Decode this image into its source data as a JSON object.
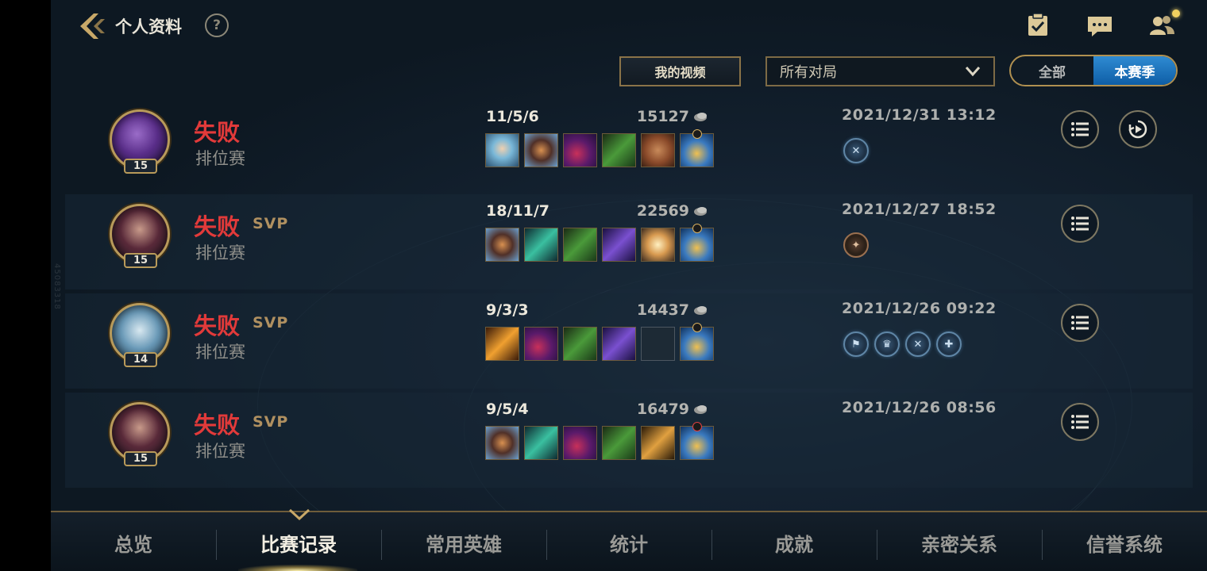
{
  "header": {
    "title": "个人资料",
    "help_glyph": "?",
    "icons": [
      "back-icon",
      "task-checklist-icon",
      "chat-icon",
      "friends-icon"
    ]
  },
  "filters": {
    "my_videos": "我的视频",
    "match_filter": "所有对局",
    "toggle_all": "全部",
    "toggle_season": "本赛季"
  },
  "matches": [
    {
      "result": "失败",
      "svp": "",
      "mode": "排位赛",
      "level": "15",
      "kda": "11/5/6",
      "gold": "15127",
      "date": "2021/12/31 13:12",
      "has_replay": true
    },
    {
      "result": "失败",
      "svp": "SVP",
      "mode": "排位赛",
      "level": "15",
      "kda": "18/11/7",
      "gold": "22569",
      "date": "2021/12/27 18:52",
      "has_replay": false
    },
    {
      "result": "失败",
      "svp": "SVP",
      "mode": "排位赛",
      "level": "14",
      "kda": "9/3/3",
      "gold": "14437",
      "date": "2021/12/26 09:22",
      "has_replay": false
    },
    {
      "result": "失败",
      "svp": "SVP",
      "mode": "排位赛",
      "level": "15",
      "kda": "9/5/4",
      "gold": "16479",
      "date": "2021/12/26 08:56",
      "has_replay": false
    }
  ],
  "tabs": [
    {
      "label": "总览",
      "active": false
    },
    {
      "label": "比赛记录",
      "active": true
    },
    {
      "label": "常用英雄",
      "active": false
    },
    {
      "label": "统计",
      "active": false
    },
    {
      "label": "成就",
      "active": false
    },
    {
      "label": "亲密关系",
      "active": false
    },
    {
      "label": "信誉系统",
      "active": false
    }
  ],
  "watermark": "45083318",
  "colors": {
    "defeat": "#e23a3a",
    "svp": "#b09060",
    "accent_blue": "#1e78c0",
    "gold_border": "#b89a5a"
  }
}
